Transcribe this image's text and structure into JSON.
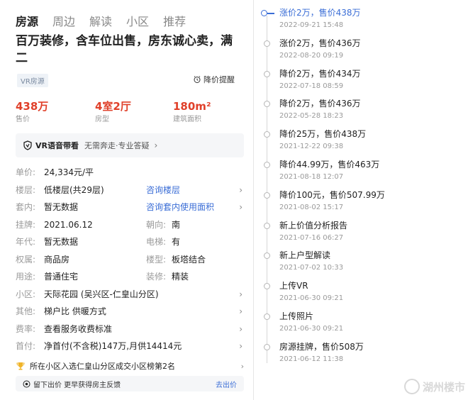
{
  "tabs": [
    {
      "label": "房源",
      "active": true
    },
    {
      "label": "周边",
      "active": false
    },
    {
      "label": "解读",
      "active": false
    },
    {
      "label": "小区",
      "active": false
    },
    {
      "label": "推荐",
      "active": false
    }
  ],
  "listing": {
    "title": "百万装修，含车位出售，房东诚心卖，满二",
    "vr_badge": "VR房源",
    "price_alert": "降价提醒",
    "stats": [
      {
        "value": "438万",
        "label": "售价"
      },
      {
        "value": "4室2厅",
        "label": "房型"
      },
      {
        "value": "180m²",
        "label": "建筑面积"
      }
    ],
    "vr_guide": {
      "bold": "VR语音带看",
      "sub": "无需奔走·专业答疑"
    },
    "unit_price": {
      "label": "单价:",
      "value": "24,334元/平"
    },
    "floor": {
      "label": "楼层:",
      "value": "低楼层(共29层)",
      "link": "咨询楼层"
    },
    "interior": {
      "label": "套内:",
      "value": "暂无数据",
      "link": "咨询套内使用面积"
    },
    "listed": {
      "label": "挂牌:",
      "value": "2021.06.12",
      "label2": "朝向:",
      "value2": "南"
    },
    "year": {
      "label": "年代:",
      "value": "暂无数据",
      "label2": "电梯:",
      "value2": "有"
    },
    "ownership": {
      "label": "权属:",
      "value": "商品房",
      "label2": "楼型:",
      "value2": "板塔结合"
    },
    "usage": {
      "label": "用途:",
      "value": "普通住宅",
      "label2": "装修:",
      "value2": "精装"
    },
    "community": {
      "label": "小区:",
      "value": "天际花园 (吴兴区-仁皇山分区)"
    },
    "other": {
      "label": "其他:",
      "value": "梯户比 供暖方式"
    },
    "fees": {
      "label": "费率:",
      "value": "查看服务收费标准"
    },
    "down_payment": {
      "label": "首付:",
      "value": "净首付(不含税)147万,月供14414元"
    },
    "rank_text": "所在小区入选仁皇山分区成交小区榜第2名",
    "bottom": {
      "text": "留下出价 更早获得房主反馈",
      "action": "去出价"
    }
  },
  "timeline": [
    {
      "title": "涨价2万，售价438万",
      "date": "2022-09-21 15:48",
      "current": true
    },
    {
      "title": "涨价2万，售价436万",
      "date": "2022-08-20 09:19"
    },
    {
      "title": "降价2万，售价434万",
      "date": "2022-07-18 08:59"
    },
    {
      "title": "降价2万，售价436万",
      "date": "2022-05-28 18:23"
    },
    {
      "title": "降价25万，售价438万",
      "date": "2021-12-22 09:38"
    },
    {
      "title": "降价44.99万，售价463万",
      "date": "2021-08-18 12:07"
    },
    {
      "title": "降价100元，售价507.99万",
      "date": "2021-08-02 15:17"
    },
    {
      "title": "新上价值分析报告",
      "date": "2021-07-16 06:27"
    },
    {
      "title": "新上户型解读",
      "date": "2021-07-02 10:33"
    },
    {
      "title": "上传VR",
      "date": "2021-06-30 09:21"
    },
    {
      "title": "上传照片",
      "date": "2021-06-30 09:21"
    },
    {
      "title": "房源挂牌，售价508万",
      "date": "2021-06-12 11:38"
    }
  ],
  "watermark": "湖州楼市",
  "colors": {
    "accent_red": "#e0402a",
    "link_blue": "#3a6dd6"
  }
}
